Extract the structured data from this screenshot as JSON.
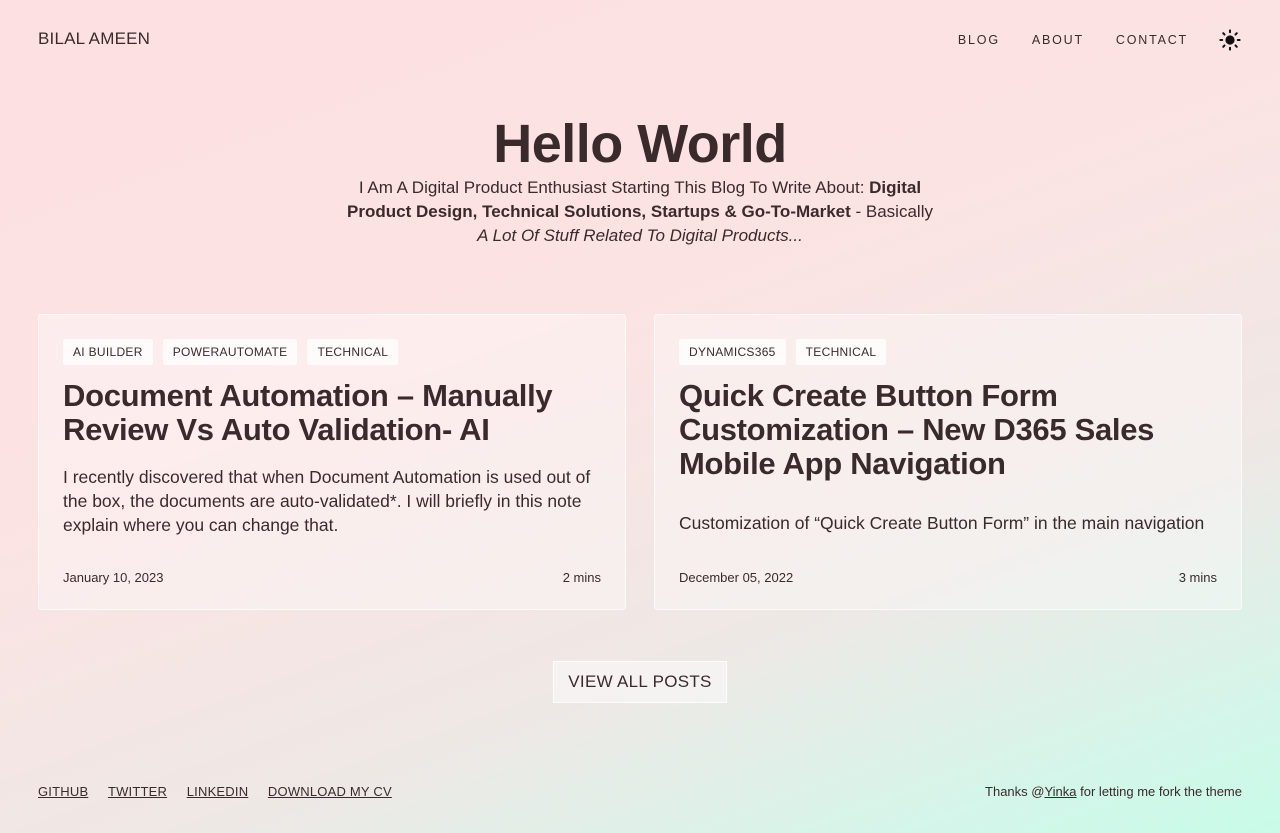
{
  "header": {
    "brand": "BILAL AMEEN",
    "nav": [
      "BLOG",
      "ABOUT",
      "CONTACT"
    ],
    "theme_icon": "sun-icon"
  },
  "hero": {
    "title": "Hello World",
    "intro": "I Am A Digital Product Enthusiast Starting This Blog To Write About: ",
    "topics": "Digital Product Design, Technical Solutions, Startups & Go-To-Market",
    "dash": " - Basically ",
    "tail": "A Lot Of Stuff Related To Digital Products..."
  },
  "posts": [
    {
      "tags": [
        "AI BUILDER",
        "POWERAUTOMATE",
        "TECHNICAL"
      ],
      "title": "Document Automation – Manually Review Vs Auto Validation- AI",
      "excerpt": "I recently discovered that when Document Automation is used out of the box, the documents are auto-validated*. I will briefly in this note explain where you can change that.",
      "date": "January 10, 2023",
      "read_time": "2 mins"
    },
    {
      "tags": [
        "DYNAMICS365",
        "TECHNICAL"
      ],
      "title": "Quick Create Button Form Customization – New D365 Sales Mobile App Navigation",
      "excerpt": "Customization of “Quick Create Button Form” in the main navigation",
      "date": "December 05, 2022",
      "read_time": "3 mins"
    }
  ],
  "view_all_label": "VIEW ALL POSTS",
  "footer": {
    "links": [
      "GITHUB",
      "TWITTER",
      "LINKEDIN",
      "DOWNLOAD MY CV"
    ],
    "credit_prefix": "Thanks @",
    "credit_link": "Yinka",
    "credit_suffix": " for letting me fork the theme"
  }
}
